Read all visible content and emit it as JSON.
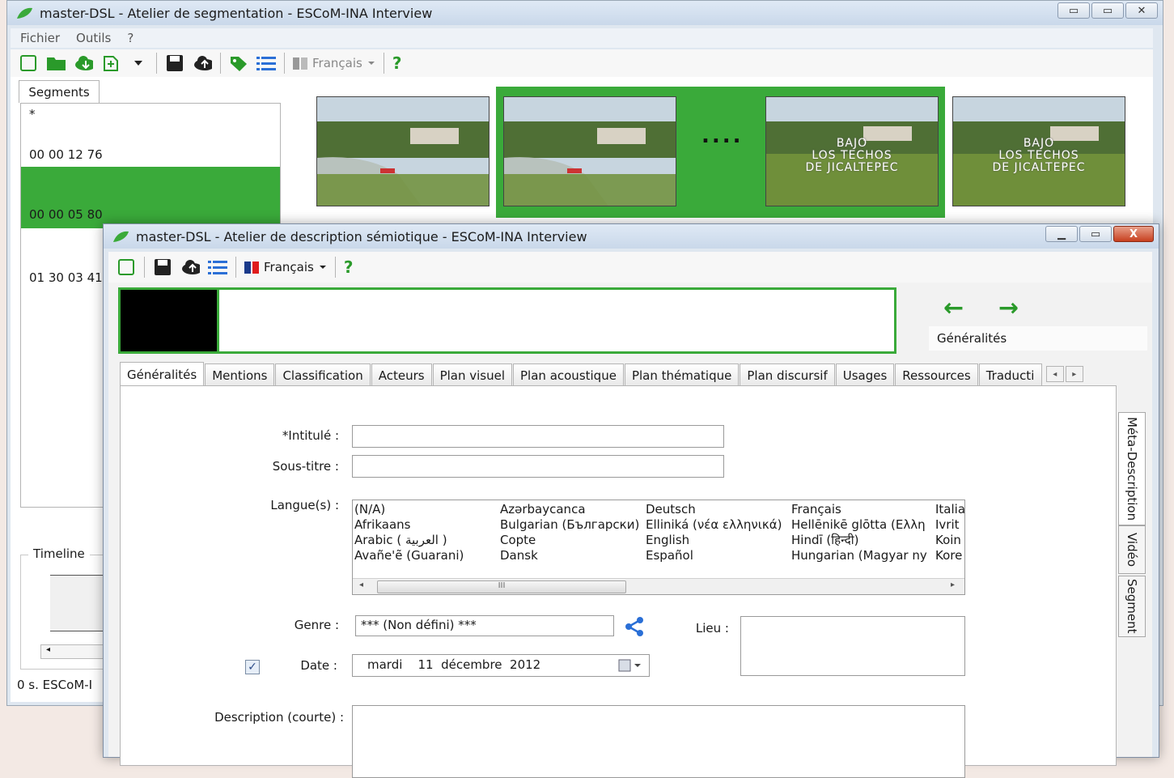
{
  "back_window": {
    "title": "master-DSL - Atelier de segmentation - ESCoM-INA Interview",
    "controls": {
      "minimize": "▭",
      "maximize": "▭",
      "close": "✕"
    },
    "menu": [
      "Fichier",
      "Outils",
      "?"
    ],
    "toolbar": {
      "language": "Français",
      "help": "?"
    },
    "segments_tab": "Segments",
    "segments": [
      {
        "label": "*"
      },
      {
        "label": "00 00 12 76"
      },
      {
        "label": "00 00 05 80",
        "selected": true
      },
      {
        "label": "01 30 03 41"
      }
    ],
    "thumbnails": [
      {
        "caption": ""
      },
      {
        "caption": ""
      },
      {
        "caption": "BAJO\nLOS TECHOS\nDE JICALTEPEC"
      },
      {
        "caption": "BAJO\nLOS TECHOS\nDE JICALTEPEC"
      }
    ],
    "thumb_dots": "....",
    "timeline_label": "Timeline",
    "status": "0 s.  ESCoM-I"
  },
  "front_window": {
    "title": "master-DSL - Atelier de description sémiotique - ESCoM-INA Interview",
    "controls": {
      "minimize": "▁",
      "maximize": "▭",
      "close": "X"
    },
    "toolbar": {
      "language": "Français",
      "help": "?"
    },
    "nav": {
      "prev": "←",
      "next": "→",
      "section": "Généralités"
    },
    "tabs": [
      "Généralités",
      "Mentions",
      "Classification",
      "Acteurs",
      "Plan visuel",
      "Plan acoustique",
      "Plan thématique",
      "Plan discursif",
      "Usages",
      "Ressources",
      "Traducti"
    ],
    "side_tabs": [
      "Méta-Description",
      "Vidéo",
      "Segment"
    ],
    "form": {
      "intitule_label": "*Intitulé :",
      "intitule_value": "",
      "soustitre_label": "Sous-titre :",
      "soustitre_value": "",
      "langues_label": "Langue(s) :",
      "langues_columns": [
        [
          "(N/A)",
          "Afrikaans",
          "Arabic ( العربية )",
          "Avañe'ẽ (Guarani)"
        ],
        [
          "Azərbaycanca",
          "Bulgarian (Български)",
          "Copte",
          "Dansk"
        ],
        [
          "Deutsch",
          "Elliniká (νέα ελληνικά)",
          "English",
          "Español"
        ],
        [
          "Français",
          "Hellēnikē glōtta (Ελλη",
          "Hindī (हिन्दी)",
          "Hungarian (Magyar ny"
        ],
        [
          "Italia",
          "Ivrit",
          "Koin",
          "Kore"
        ]
      ],
      "scroll_grip": "III",
      "genre_label": "Genre :",
      "genre_value": "*** (Non défini) ***",
      "lieu_label": "Lieu :",
      "date_checked": true,
      "date_label": "Date :",
      "date_value": "mardi    11  décembre  2012",
      "description_label": "Description (courte) :"
    }
  },
  "colors": {
    "accent_green": "#3aaa3a",
    "titlebar": "#c9d8ea"
  }
}
